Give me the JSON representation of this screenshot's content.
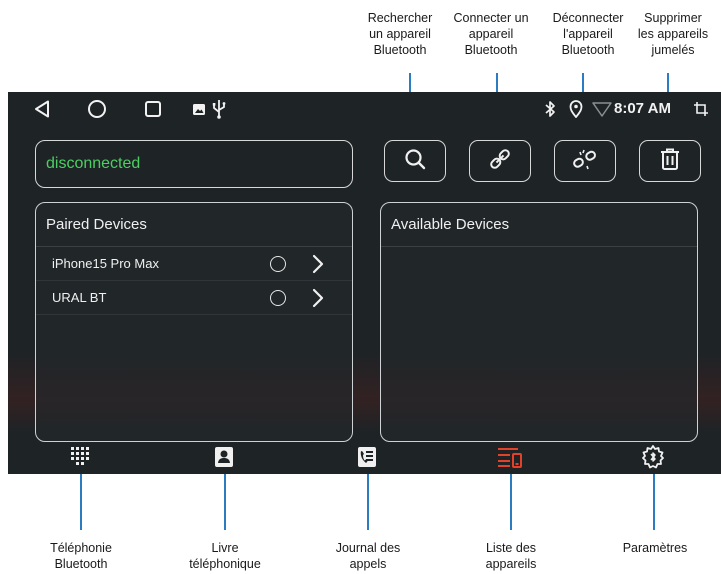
{
  "callouts_top": [
    {
      "lines": [
        "Rechercher",
        "un appareil",
        "Bluetooth"
      ]
    },
    {
      "lines": [
        "Connecter un",
        "appareil",
        "Bluetooth"
      ]
    },
    {
      "lines": [
        "Déconnecter",
        "l'appareil",
        "Bluetooth"
      ]
    },
    {
      "lines": [
        "Supprimer",
        "les appareils",
        "jumelés"
      ]
    }
  ],
  "callouts_bottom": [
    {
      "lines": [
        "Téléphonie",
        "Bluetooth"
      ]
    },
    {
      "lines": [
        "Livre",
        "téléphonique"
      ]
    },
    {
      "lines": [
        "Journal des",
        "appels"
      ]
    },
    {
      "lines": [
        "Liste des",
        "appareils"
      ]
    },
    {
      "lines": [
        "Paramètres"
      ]
    }
  ],
  "status_bar": {
    "time": "8:07 AM",
    "left_icons": [
      "back-icon",
      "home-icon",
      "recents-icon",
      "gallery-icon",
      "usb-icon"
    ],
    "right_icons": [
      "bluetooth-icon",
      "location-icon",
      "wifi-icon",
      "screenshot-icon"
    ]
  },
  "connection": {
    "status": "disconnected",
    "status_color": "#4ccf62"
  },
  "toolbar": {
    "buttons": [
      "search-icon",
      "link-icon",
      "unlink-icon",
      "trash-icon"
    ]
  },
  "paired_panel": {
    "title": "Paired Devices",
    "devices": [
      {
        "name": "iPhone15 Pro Max"
      },
      {
        "name": "URAL BT"
      }
    ]
  },
  "available_panel": {
    "title": "Available Devices",
    "devices": []
  },
  "bottom_nav": {
    "items": [
      "dialpad-icon",
      "contacts-icon",
      "call-log-icon",
      "device-list-icon",
      "settings-icon"
    ],
    "active_index": 3,
    "active_color": "#e2412a"
  },
  "colors": {
    "callout_line": "#2c7cc1",
    "screen_bg": "#1e2326"
  }
}
